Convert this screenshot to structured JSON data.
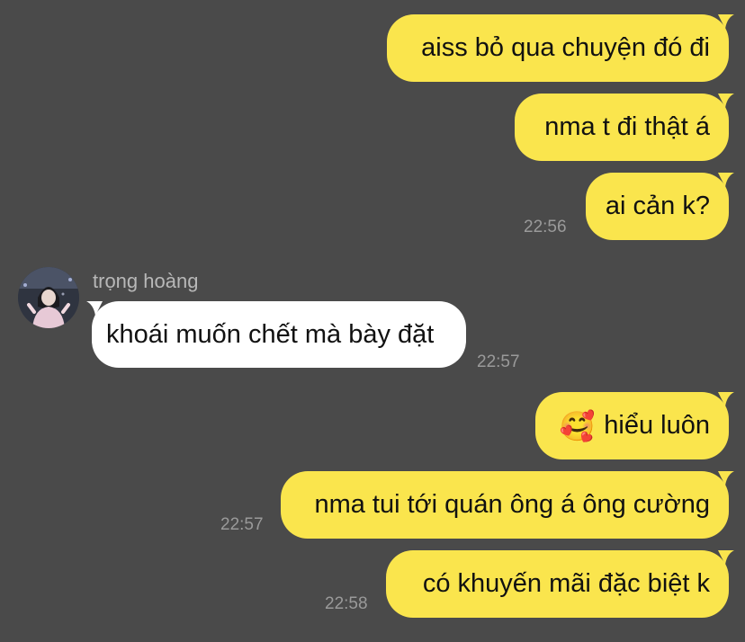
{
  "messages": [
    {
      "side": "out",
      "text": "aiss bỏ qua chuyện đó đi"
    },
    {
      "side": "out",
      "text": "nma t đi thật á"
    },
    {
      "side": "out",
      "text": "ai cản k?",
      "time": "22:56"
    },
    {
      "side": "in",
      "sender": "trọng hoàng",
      "text": "khoái muốn chết mà bày đặt",
      "time": "22:57"
    },
    {
      "side": "out",
      "emoji": "🥰",
      "text": "hiểu luôn"
    },
    {
      "side": "out",
      "text": "nma tui tới quán ông á ông cường",
      "time": "22:57"
    },
    {
      "side": "out",
      "text": "có khuyến mãi đặc biệt k",
      "time": "22:58"
    }
  ],
  "colors": {
    "background": "#4a4a4a",
    "outgoing_bubble": "#fae54d",
    "incoming_bubble": "#ffffff",
    "timestamp": "#9a9a9a",
    "sender_name": "#b8b8b8"
  }
}
